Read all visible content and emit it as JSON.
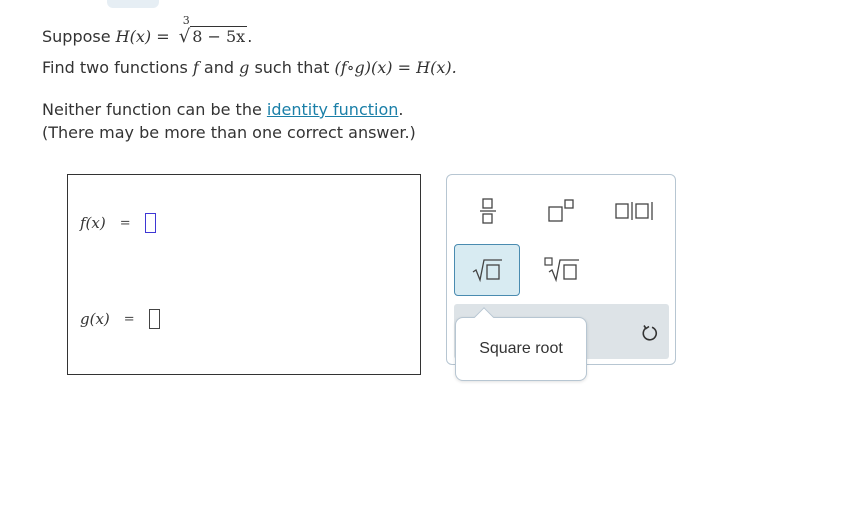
{
  "question": {
    "suppose_word": "Suppose",
    "H_fn": "H",
    "var_x_1": "(x)",
    "equals": "=",
    "root_index": "3",
    "radicand": "8 − 5x",
    "period": ".",
    "find_prefix": "Find two functions",
    "f_name": "f",
    "and_word": "and",
    "g_name": "g",
    "such_that": "such that",
    "composition": "(f∘g)(x) = H(x).",
    "note_prefix": "Neither function can be the",
    "identity_link": "identity function",
    "note_period": ".",
    "hint": "(There may be more than one correct answer.)"
  },
  "answers": {
    "f_label": "f(x)",
    "g_label": "g(x)",
    "eq": "=",
    "f_value": "",
    "g_value": ""
  },
  "palette": {
    "buttons": [
      "fraction-button",
      "superscript-button",
      "absolute-value-button",
      "square-root-button",
      "nth-root-button"
    ],
    "active": "square-root-button",
    "tooltip": "Square root",
    "undo_icon": "undo-icon"
  },
  "colors": {
    "accent": "#3e37d4",
    "link": "#1a7fa8",
    "active_bg": "#d8ebf2",
    "toolbar_bg": "#dde3e7"
  }
}
